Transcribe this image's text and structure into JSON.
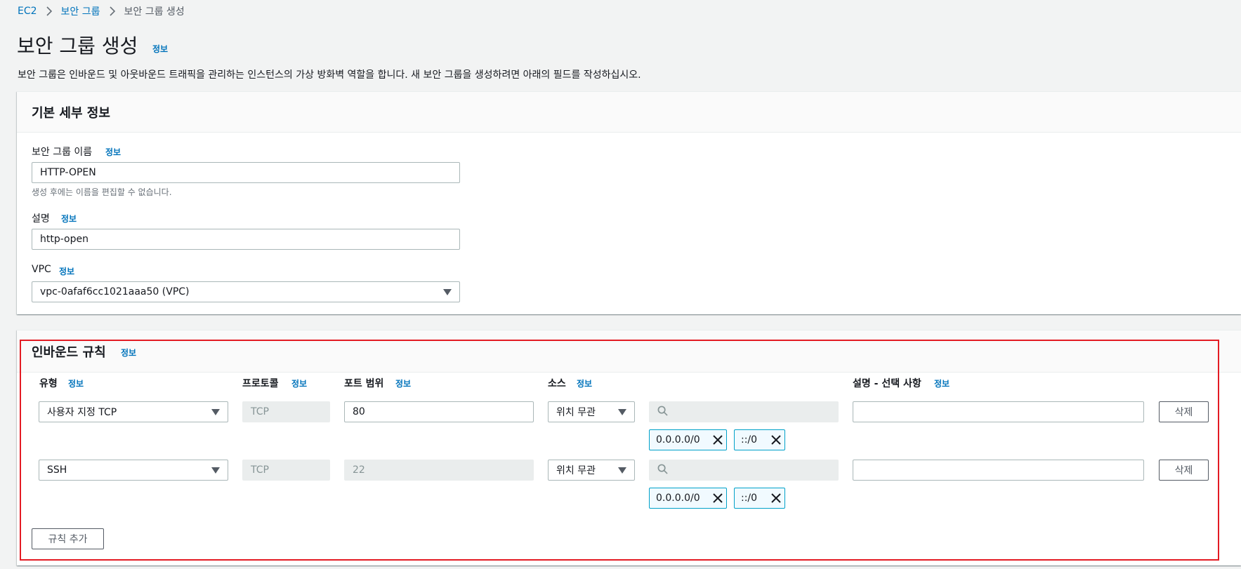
{
  "breadcrumb": {
    "items": [
      {
        "label": "EC2"
      },
      {
        "label": "보안 그룹"
      },
      {
        "label": "보안 그룹 생성"
      }
    ]
  },
  "page": {
    "title": "보안 그룹 생성",
    "info": "정보",
    "description": "보안 그룹은 인바운드 및 아웃바운드 트래픽을 관리하는 인스턴스의 가상 방화벽 역할을 합니다. 새 보안 그룹을 생성하려면 아래의 필드를 작성하십시오."
  },
  "basic": {
    "title": "기본 세부 정보",
    "name_label": "보안 그룹 이름",
    "name_info": "정보",
    "name_value": "HTTP-OPEN",
    "name_hint": "생성 후에는 이름을 편집할 수 없습니다.",
    "desc_label": "설명",
    "desc_info": "정보",
    "desc_value": "http-open",
    "vpc_label": "VPC",
    "vpc_info": "정보",
    "vpc_value": "vpc-0afaf6cc1021aaa50 (VPC)"
  },
  "inbound": {
    "title": "인바운드 규칙",
    "info": "정보",
    "columns": {
      "type": "유형",
      "type_info": "정보",
      "protocol": "프로토콜",
      "protocol_info": "정보",
      "port": "포트 범위",
      "port_info": "정보",
      "source": "소스",
      "source_info": "정보",
      "desc": "설명 - 선택 사항",
      "desc_info": "정보"
    },
    "rules": [
      {
        "type": "사용자 지정 TCP",
        "protocol": "TCP",
        "port": "80",
        "source": "위치 무관",
        "search_value": "",
        "tokens": [
          "0.0.0.0/0",
          "::/0"
        ],
        "description": "",
        "delete_label": "삭제"
      },
      {
        "type": "SSH",
        "protocol": "TCP",
        "port": "22",
        "source": "위치 무관",
        "search_value": "",
        "tokens": [
          "0.0.0.0/0",
          "::/0"
        ],
        "description": "",
        "delete_label": "삭제"
      }
    ],
    "add_rule_label": "규칙 추가"
  },
  "colors": {
    "link": "#0073bb",
    "highlight": "#e31b23",
    "token_border": "#00a1c9"
  }
}
